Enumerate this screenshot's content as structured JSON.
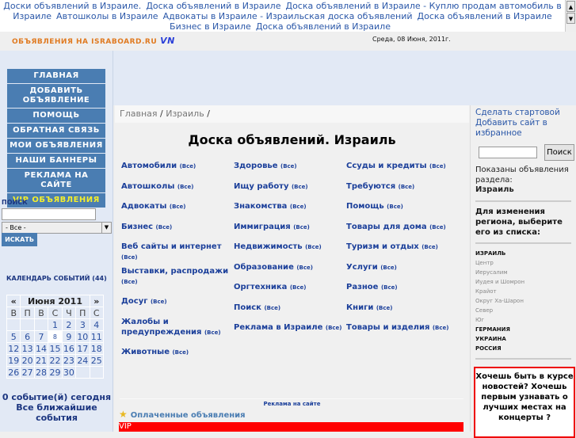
{
  "ticker": [
    "Доски объявлений в Израиле.",
    "Доска объявлений в Израиле",
    "Доска объявлений в Израиле - Куплю продам автомобиль в Израиле",
    "Автошколы в Израиле",
    "Адвокаты в Израиле - Израильская доска объявлений",
    "Доска объявлений в Израиле Бизнес в Израиле",
    "Доска объявлений в Израиле"
  ],
  "header": {
    "logo": "ОБЪЯВЛЕНИЯ НА ISRABOARD.RU",
    "logo_suffix": "VN",
    "date": "Среда, 08 Июня, 2011г."
  },
  "menu": [
    "ГЛАВНАЯ",
    "ДОБАВИТЬ ОБЪЯВЛЕНИЕ",
    "ПОМОЩЬ",
    "ОБРАТНАЯ СВЯЗЬ",
    "МОИ ОБЪЯВЛЕНИЯ",
    "НАШИ БАННЕРЫ",
    "РЕКЛАМА НА САЙТЕ",
    "VIP ОБЪЯВЛЕНИЯ"
  ],
  "search": {
    "label": "ПОИСК",
    "value": "",
    "select": "- Все -",
    "button": "ИСКАТЬ"
  },
  "calendar": {
    "label": "КАЛЕНДАРЬ СОБЫТИЙ (44)",
    "prev": "«",
    "next": "»",
    "month": "Июня 2011",
    "weekdays": [
      "В",
      "П",
      "В",
      "С",
      "Ч",
      "П",
      "С"
    ],
    "weeks": [
      [
        "",
        "",
        "",
        "1",
        "2",
        "3",
        "4"
      ],
      [
        "5",
        "6",
        "7",
        "8",
        "9",
        "10",
        "11"
      ],
      [
        "12",
        "13",
        "14",
        "15",
        "16",
        "17",
        "18"
      ],
      [
        "19",
        "20",
        "21",
        "22",
        "23",
        "24",
        "25"
      ],
      [
        "26",
        "27",
        "28",
        "29",
        "30",
        "",
        ""
      ]
    ],
    "today": "8",
    "events_today": "0 событие(й) сегодня",
    "upcoming": "Все ближайшие события"
  },
  "breadcrumb": [
    "Главная",
    "Израиль"
  ],
  "page_title": "Доска объявлений. Израиль",
  "all_label": "(Все)",
  "categories": [
    [
      "Автомобили",
      "Автошколы",
      "Адвокаты",
      "Бизнес",
      "Веб сайты и интернет",
      "Выставки, распродажи",
      "Досуг",
      "Жалобы и предупреждения",
      "Животные"
    ],
    [
      "Здоровье",
      "Ищу работу",
      "Знакомства",
      "Иммиграция",
      "Недвижимость",
      "Образование",
      "Оргтехника",
      "Поиск",
      "Реклама в Израиле"
    ],
    [
      "Ссуды и кредиты",
      "Требуются",
      "Помощь",
      "Товары для дома",
      "Туризм и отдых",
      "Услуги",
      "Разное",
      "Книги",
      "Товары и изделия"
    ]
  ],
  "ad_link": "Реклама на сайте",
  "paid": {
    "title": "Оплаченные объявления",
    "vip": "VIP"
  },
  "right": {
    "make_home": "Сделать стартовой",
    "add_fav": "Добавить сайт в избранное",
    "search_button": "Поиск",
    "shown_label": "Показаны объявления раздела:",
    "section": "Израиль",
    "change_region": "Для изменения региона, выберите его из списка:",
    "regions": [
      {
        "name": "ИЗРАИЛЬ",
        "bold": true
      },
      {
        "name": "Центр"
      },
      {
        "name": "Иерусалим"
      },
      {
        "name": "Иудея и Шомрон"
      },
      {
        "name": "Крайот"
      },
      {
        "name": "Округ Ха-Шарон"
      },
      {
        "name": "Север"
      },
      {
        "name": "Юг"
      },
      {
        "name": "ГЕРМАНИЯ",
        "bold": true
      },
      {
        "name": "УКРАИНА",
        "bold": true
      },
      {
        "name": "РОССИЯ",
        "bold": true
      }
    ],
    "promo": "Хочешь быть в курсе новостей? Хочешь первым узнавать о лучших местах на концерты ?"
  }
}
